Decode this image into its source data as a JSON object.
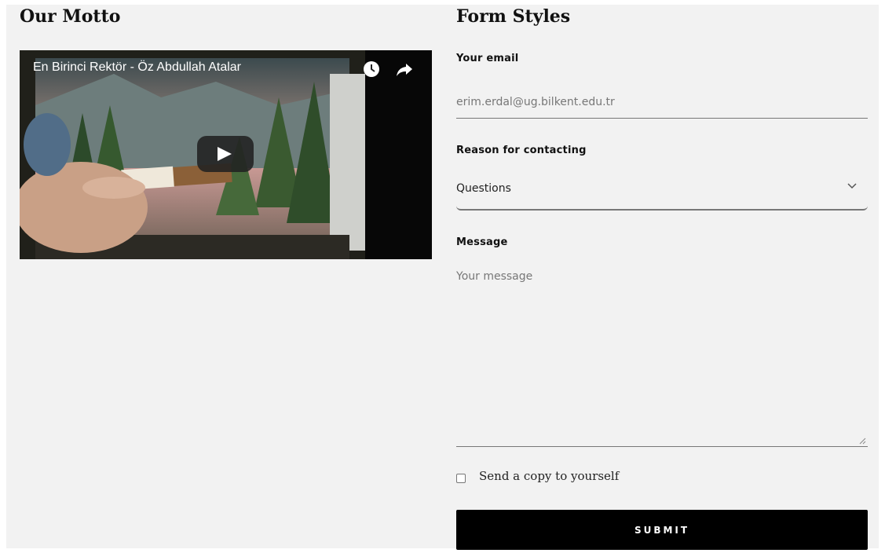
{
  "left": {
    "heading": "Our Motto",
    "video": {
      "title": "En Birinci Rektör - Öz Abdullah Atalar",
      "icons": [
        "watch-later-icon",
        "share-icon",
        "play-icon"
      ]
    }
  },
  "right": {
    "heading": "Form Styles",
    "email": {
      "label": "Your email",
      "placeholder": "erim.erdal@ug.bilkent.edu.tr"
    },
    "reason": {
      "label": "Reason for contacting",
      "selected": "Questions"
    },
    "message": {
      "label": "Message",
      "placeholder": "Your message"
    },
    "copy_label": "Send a copy to yourself",
    "submit_label": "SUBMIT"
  },
  "colors": {
    "page_bg": "#f2f2f2",
    "button_bg": "#000000",
    "button_text": "#ffffff",
    "underline": "#777777"
  }
}
